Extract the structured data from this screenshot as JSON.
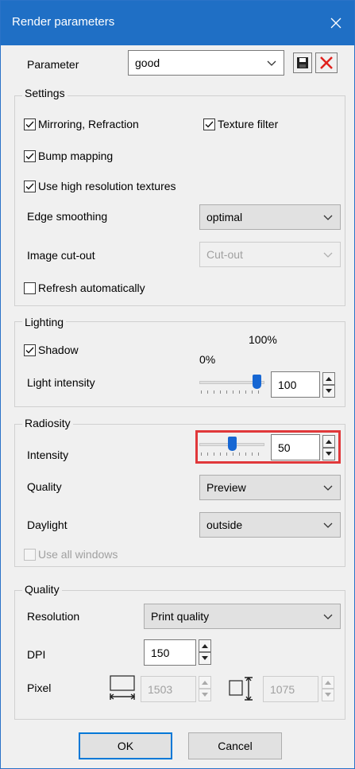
{
  "window": {
    "title": "Render parameters"
  },
  "parameter": {
    "label": "Parameter",
    "value": "good"
  },
  "settings": {
    "group_label": "Settings",
    "mirroring": {
      "label": "Mirroring, Refraction",
      "checked": true
    },
    "texture_filter": {
      "label": "Texture filter",
      "checked": true
    },
    "bump_mapping": {
      "label": "Bump mapping",
      "checked": true
    },
    "high_res_textures": {
      "label": "Use high resolution textures",
      "checked": true
    },
    "edge_smoothing": {
      "label": "Edge smoothing",
      "value": "optimal"
    },
    "image_cutout": {
      "label": "Image cut-out",
      "value": "Cut-out",
      "enabled": false
    },
    "refresh_auto": {
      "label": "Refresh automatically",
      "checked": false
    }
  },
  "lighting": {
    "group_label": "Lighting",
    "shadow": {
      "label": "Shadow",
      "checked": true
    },
    "scale_min": "0%",
    "scale_max": "100%",
    "light_intensity": {
      "label": "Light intensity",
      "value": "100",
      "slider_fraction": 0.95
    }
  },
  "radiosity": {
    "group_label": "Radiosity",
    "intensity": {
      "label": "Intensity",
      "value": "50",
      "slider_fraction": 0.5
    },
    "quality": {
      "label": "Quality",
      "value": "Preview"
    },
    "daylight": {
      "label": "Daylight",
      "value": "outside"
    },
    "use_all_windows": {
      "label": "Use all windows",
      "checked": false,
      "enabled": false
    }
  },
  "quality": {
    "group_label": "Quality",
    "resolution": {
      "label": "Resolution",
      "value": "Print quality"
    },
    "dpi": {
      "label": "DPI",
      "value": "150"
    },
    "pixel": {
      "label": "Pixel",
      "width": "1503",
      "height": "1075"
    }
  },
  "buttons": {
    "ok": "OK",
    "cancel": "Cancel"
  },
  "colors": {
    "titlebar": "#1f6fc5",
    "highlight": "#e0383a",
    "accent": "#0078d7"
  },
  "icons": {
    "save": "save-icon",
    "delete": "delete-icon",
    "close": "close-icon",
    "width": "width-icon",
    "height": "height-icon"
  }
}
